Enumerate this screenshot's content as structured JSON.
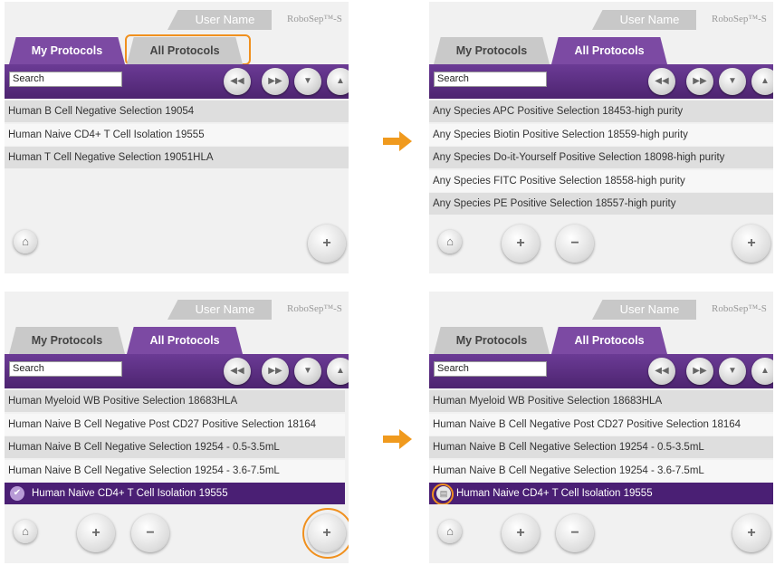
{
  "header": {
    "username": "User Name",
    "brand": "RoboSep™-S"
  },
  "tabs": {
    "my_protocols": "My Protocols",
    "all_protocols": "All Protocols"
  },
  "search": {
    "value": "Search"
  },
  "nav": {
    "first": "◀◀",
    "next": "▶▶",
    "down": "▼",
    "up": "▲"
  },
  "icons": {
    "home": "⌂",
    "add": "+",
    "remove": "−",
    "doc": "+"
  },
  "accent_color": "#7c4aa3",
  "highlight_color": "#f0901e",
  "panels": [
    {
      "rows": [
        "Human B Cell Negative Selection 19054",
        "Human Naive CD4+ T Cell Isolation 19555",
        "Human T Cell Negative Selection 19051HLA"
      ]
    },
    {
      "rows": [
        "Any Species APC Positive Selection 18453-high purity",
        "Any Species Biotin Positive Selection 18559-high purity",
        "Any Species Do-it-Yourself Positive Selection 18098-high purity",
        "Any Species FITC Positive Selection 18558-high purity",
        "Any Species PE Positive Selection 18557-high purity"
      ]
    },
    {
      "rows": [
        "Human Myeloid WB Positive Selection 18683HLA",
        "Human Naive B Cell Negative Post CD27 Positive Selection 18164",
        "Human Naive B Cell Negative Selection 19254 - 0.5-3.5mL",
        "Human Naive B Cell Negative Selection 19254 - 3.6-7.5mL",
        "Human Naive CD4+ T Cell Isolation 19555"
      ]
    },
    {
      "rows": [
        "Human Myeloid WB Positive Selection 18683HLA",
        "Human Naive B Cell Negative Post CD27 Positive Selection 18164",
        "Human Naive B Cell Negative Selection 19254 - 0.5-3.5mL",
        "Human Naive B Cell Negative Selection 19254 - 3.6-7.5mL",
        "Human Naive CD4+ T Cell Isolation 19555"
      ]
    }
  ]
}
